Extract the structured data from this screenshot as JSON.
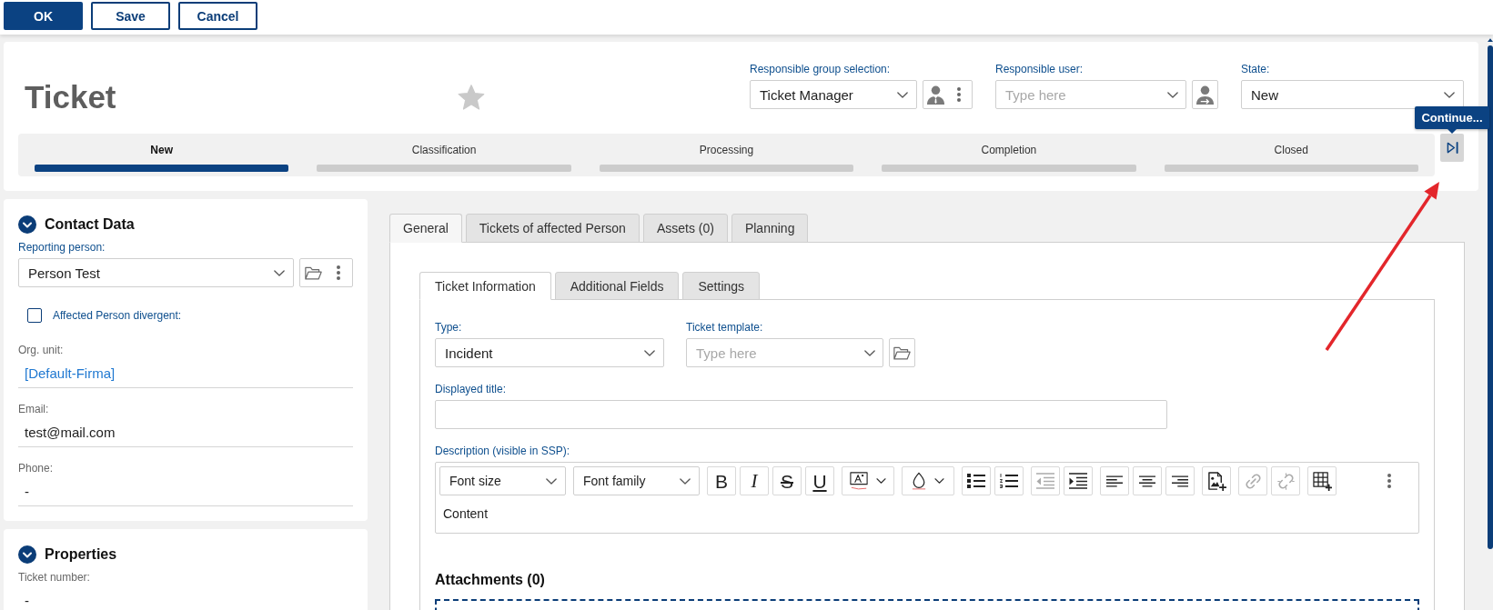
{
  "action_bar": {
    "buttons": [
      {
        "label": "OK",
        "kind": "primary"
      },
      {
        "label": "Save",
        "kind": "secondary"
      },
      {
        "label": "Cancel",
        "kind": "secondary"
      }
    ]
  },
  "header": {
    "title": "Ticket",
    "favorite": false,
    "fields": [
      {
        "label": "Responsible group selection:",
        "value": "Ticket Manager",
        "actions": [
          {
            "kind": "person"
          },
          {
            "kind": "more"
          }
        ]
      },
      {
        "label": "Responsible user:",
        "placeholder": "Type here",
        "actions": [
          {
            "kind": "person-swap"
          }
        ]
      },
      {
        "label": "State:",
        "value": "New"
      }
    ],
    "steps": [
      {
        "label": "New",
        "selected": true
      },
      {
        "label": "Classification",
        "selected": false
      },
      {
        "label": "Processing",
        "selected": false
      },
      {
        "label": "Completion",
        "selected": false
      },
      {
        "label": "Closed",
        "selected": false
      }
    ],
    "next_button": {
      "tooltip": "Continue..."
    }
  },
  "contact_data": {
    "title": "Contact Data",
    "expanded": true,
    "reporting_person": {
      "label": "Reporting person:",
      "value": "Person Test",
      "actions": [
        {
          "kind": "folder"
        },
        {
          "kind": "more"
        }
      ]
    },
    "affected_person_divergent": {
      "label": "Affected Person divergent:",
      "checked": false
    },
    "fields": [
      {
        "label": "Org. unit:",
        "value": "[Default-Firma]",
        "kind": "link"
      },
      {
        "label": "Email:",
        "value": "test@mail.com",
        "kind": "text"
      },
      {
        "label": "Phone:",
        "value": "-",
        "kind": "text"
      }
    ]
  },
  "properties": {
    "title": "Properties",
    "expanded": true,
    "fields": [
      {
        "label": "Ticket number:",
        "value": "-",
        "kind": "text"
      }
    ]
  },
  "tabs": [
    {
      "label": "General",
      "selected": true
    },
    {
      "label": "Tickets of affected Person",
      "selected": false
    },
    {
      "label": "Assets (0)",
      "selected": false
    },
    {
      "label": "Planning",
      "selected": false
    }
  ],
  "subtabs": [
    {
      "label": "Ticket Information",
      "selected": true
    },
    {
      "label": "Additional Fields",
      "selected": false
    },
    {
      "label": "Settings",
      "selected": false
    }
  ],
  "form": {
    "type": {
      "label": "Type:",
      "value": "Incident"
    },
    "ticket_template": {
      "label": "Ticket template:",
      "placeholder": "Type here",
      "actions": [
        {
          "kind": "folder"
        }
      ]
    },
    "displayed_title": {
      "label": "Displayed title:"
    },
    "description": {
      "label": "Description (visible in SSP):",
      "font_size": "Font size",
      "font_family": "Font family",
      "tool_groups": [
        [
          {
            "kind": "bold",
            "label": "B",
            "disabled": false
          },
          {
            "kind": "italic",
            "label": "I",
            "disabled": false
          },
          {
            "kind": "strikethrough",
            "label": "S",
            "disabled": false
          },
          {
            "kind": "underline",
            "label": "U",
            "disabled": false
          }
        ],
        [
          {
            "kind": "text-color",
            "disabled": false
          }
        ],
        [
          {
            "kind": "fill-color",
            "disabled": false
          }
        ],
        [
          {
            "kind": "bullet-list",
            "disabled": false
          },
          {
            "kind": "numbered-list",
            "disabled": false
          }
        ],
        [
          {
            "kind": "outdent",
            "disabled": true
          },
          {
            "kind": "indent",
            "disabled": false
          }
        ],
        [
          {
            "kind": "align-left",
            "disabled": false
          },
          {
            "kind": "align-center",
            "disabled": false
          },
          {
            "kind": "align-right",
            "disabled": false
          }
        ],
        [
          {
            "kind": "image",
            "disabled": false
          }
        ],
        [
          {
            "kind": "link",
            "disabled": true
          },
          {
            "kind": "unlink",
            "disabled": true
          }
        ],
        [
          {
            "kind": "table",
            "disabled": false
          }
        ]
      ],
      "content": "Content"
    }
  },
  "attachments": {
    "title": "Attachments (0)"
  }
}
